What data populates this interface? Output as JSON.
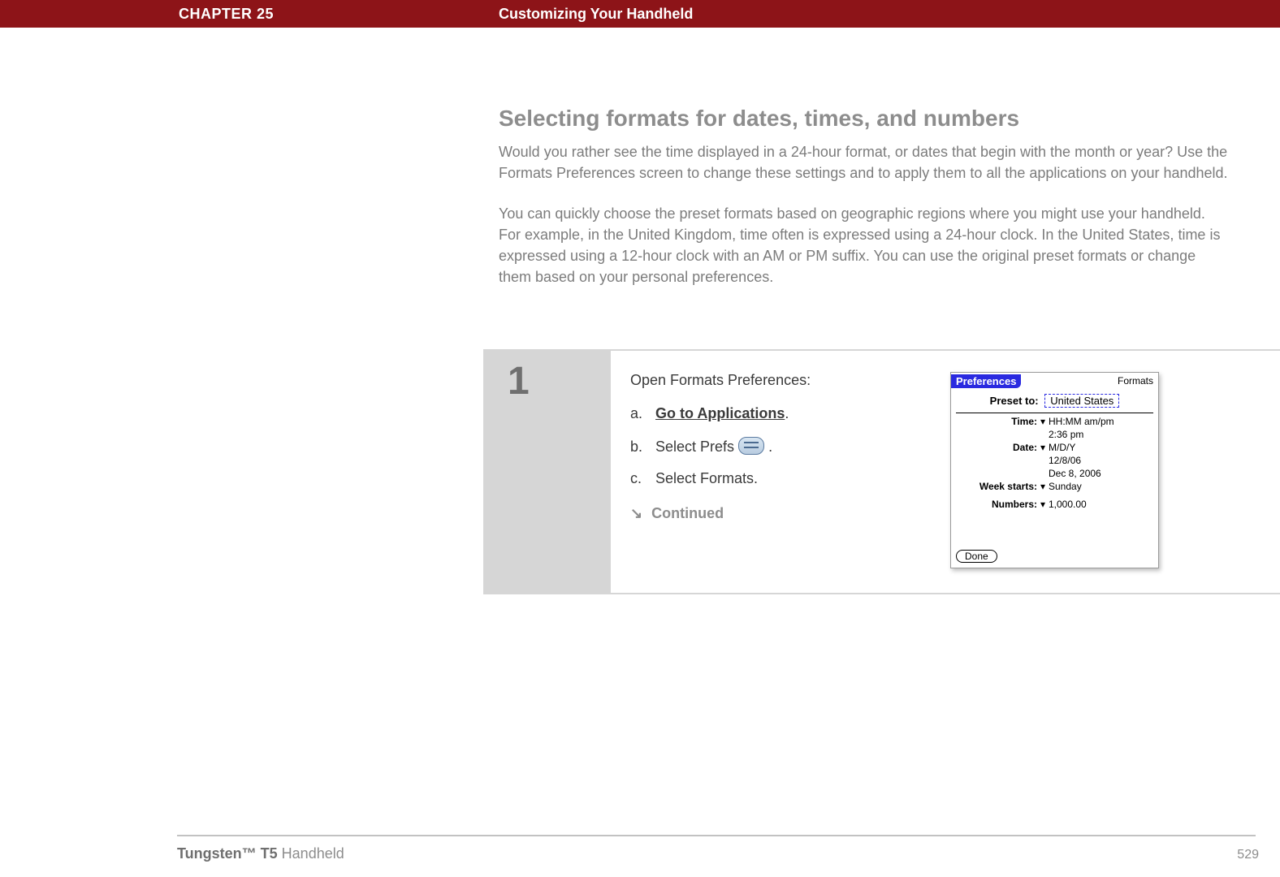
{
  "header": {
    "chapter": "CHAPTER 25",
    "title": "Customizing Your Handheld"
  },
  "section": {
    "heading": "Selecting formats for dates, times, and numbers",
    "para1": "Would you rather see the time displayed in a 24-hour format, or dates that begin with the month or year? Use the Formats Preferences screen to change these settings and to apply them to all the applications on your handheld.",
    "para2": "You can quickly choose the preset formats based on geographic regions where you might use your handheld. For example, in the United Kingdom, time often is expressed using a 24-hour clock. In the United States, time is expressed using a 12-hour clock with an AM or PM suffix. You can use the original preset formats or change them based on your personal preferences."
  },
  "step": {
    "number": "1",
    "lead": "Open Formats Preferences:",
    "a_label": "a.",
    "a_link": "Go to Applications",
    "a_tail": ".",
    "b_label": "b.",
    "b_pre": "Select Prefs ",
    "b_tail": ".",
    "c_label": "c.",
    "c_text": "Select Formats.",
    "continued": "Continued"
  },
  "palm": {
    "app": "Preferences",
    "screen": "Formats",
    "preset_label": "Preset to:",
    "preset_value": "United States",
    "time_label": "Time:",
    "time_value": "HH:MM am/pm",
    "time_example": "2:36 pm",
    "date_label": "Date:",
    "date_value": "M/D/Y",
    "date_example1": "12/8/06",
    "date_example2": "Dec 8, 2006",
    "week_label": "Week starts:",
    "week_value": "Sunday",
    "numbers_label": "Numbers:",
    "numbers_value": "1,000.00",
    "done": "Done"
  },
  "footer": {
    "product_strong": "Tungsten™ T5",
    "product_tail": " Handheld",
    "page": "529"
  }
}
